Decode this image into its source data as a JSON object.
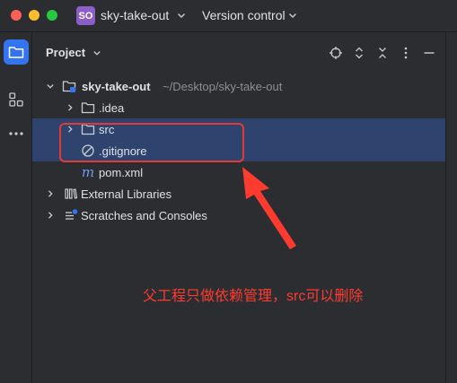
{
  "titlebar": {
    "project_badge": "SO",
    "project_name": "sky-take-out",
    "vcs_label": "Version control"
  },
  "leftbar": {
    "items": [
      {
        "name": "project-tool",
        "icon": "folder-icon"
      },
      {
        "name": "structure-tool",
        "icon": "structure-icon"
      },
      {
        "name": "more-tools",
        "icon": "more-icon"
      }
    ]
  },
  "panel": {
    "title": "Project",
    "tools": [
      "locate-icon",
      "expand-collapse-icon",
      "collapse-all-icon",
      "options-icon",
      "hide-icon"
    ]
  },
  "tree": {
    "root": {
      "label": "sky-take-out",
      "path": "~/Desktop/sky-take-out"
    },
    "idea": {
      "label": ".idea"
    },
    "src": {
      "label": "src"
    },
    "gitignore": {
      "label": ".gitignore"
    },
    "pom": {
      "label": "pom.xml"
    },
    "libs": {
      "label": "External Libraries"
    },
    "scratches": {
      "label": "Scratches and Consoles"
    }
  },
  "annotation": {
    "text": "父工程只做依赖管理，src可以删除",
    "color": "#ff3b30"
  },
  "colors": {
    "selection": "#2e436e",
    "accent": "#3574f0",
    "highlight_box": "#e53935"
  }
}
